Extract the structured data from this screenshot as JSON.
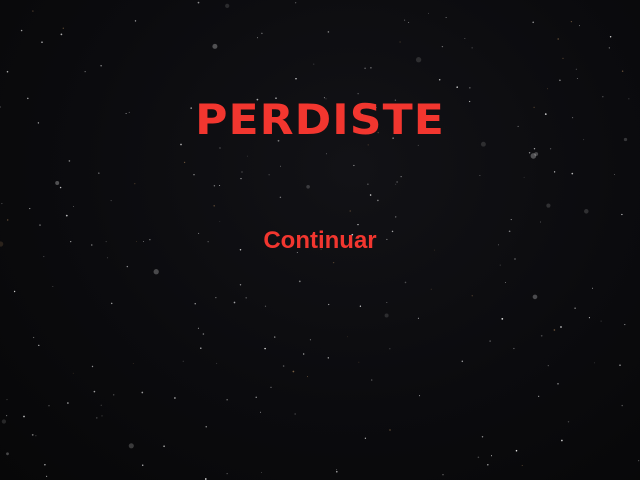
{
  "screen": {
    "title": "PERDISTE",
    "continue_label": "Continuar"
  },
  "colors": {
    "accent": "#f2362f",
    "background": "#0a0a0c",
    "star": "#ffffff",
    "dim_star": "#8a6b4a"
  }
}
